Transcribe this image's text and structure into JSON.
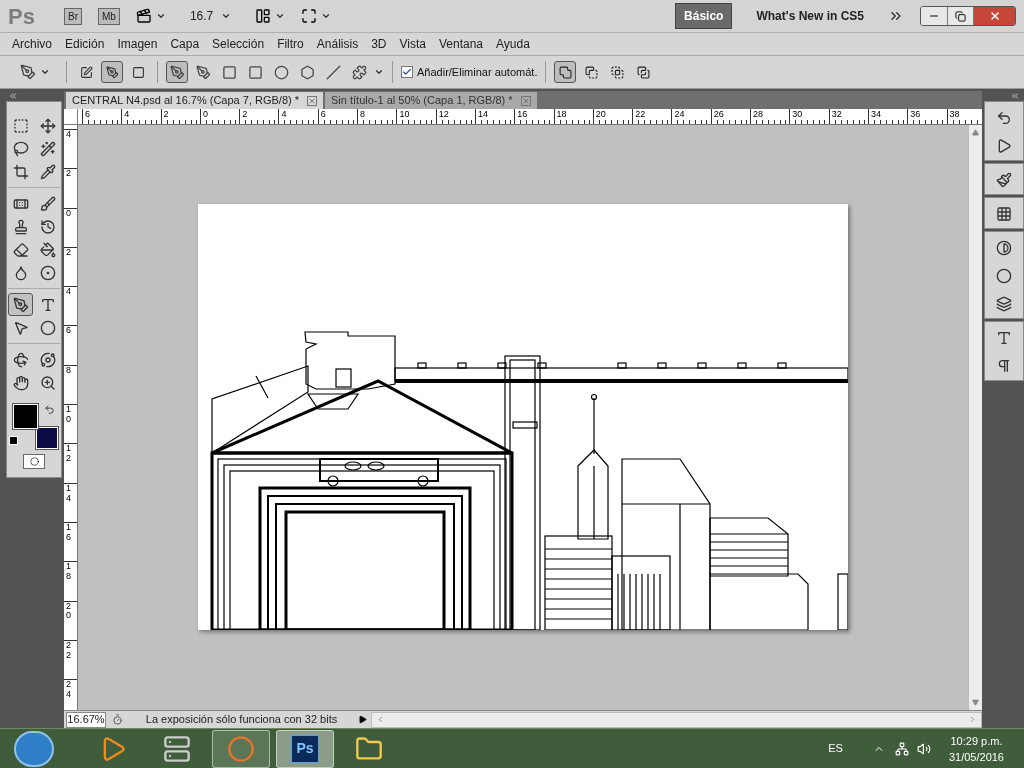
{
  "app_bar": {
    "logo": "Ps",
    "launchers": [
      "Br",
      "Mb"
    ],
    "zoom": "16.7",
    "workspaces": [
      {
        "label": "Básico",
        "selected": true
      },
      {
        "label": "What's New in CS5",
        "selected": false
      }
    ]
  },
  "menu": [
    "Archivo",
    "Edición",
    "Imagen",
    "Capa",
    "Selección",
    "Filtro",
    "Análisis",
    "3D",
    "Vista",
    "Ventana",
    "Ayuda"
  ],
  "options_bar": {
    "path_modes": [
      {
        "kind": "shape-layers",
        "selected": false
      },
      {
        "kind": "paths",
        "selected": true
      },
      {
        "kind": "fill-pixels",
        "selected": false
      }
    ],
    "draw_tools": [
      {
        "kind": "pen",
        "selected": true
      },
      {
        "kind": "freeform-pen",
        "selected": false
      },
      {
        "kind": "rectangle",
        "selected": false
      },
      {
        "kind": "rounded-rectangle",
        "selected": false
      },
      {
        "kind": "ellipse",
        "selected": false
      },
      {
        "kind": "polygon",
        "selected": false
      },
      {
        "kind": "line",
        "selected": false
      },
      {
        "kind": "custom-shape",
        "selected": false
      }
    ],
    "auto_add_delete": {
      "label": "Añadir/Eliminar automát.",
      "checked": true
    },
    "combine_modes": [
      {
        "kind": "add",
        "selected": true
      },
      {
        "kind": "subtract",
        "selected": false
      },
      {
        "kind": "intersect",
        "selected": false
      },
      {
        "kind": "exclude",
        "selected": false
      }
    ]
  },
  "document_tabs": [
    {
      "label": "CENTRAL N4.psd al 16.7% (Capa 7, RGB/8) *",
      "selected": true
    },
    {
      "label": "Sin título-1 al 50% (Capa 1, RGB/8) *",
      "selected": false
    }
  ],
  "rulers": {
    "horizontal": [
      "6",
      "4",
      "2",
      "0",
      "2",
      "4",
      "6",
      "8",
      "10",
      "12",
      "14",
      "16",
      "18",
      "20",
      "22",
      "24",
      "26",
      "28",
      "30",
      "32",
      "34",
      "36",
      "38"
    ],
    "vertical": [
      "4",
      "2",
      "0",
      "2",
      "4",
      "6",
      "8",
      "10",
      "12",
      "14",
      "16",
      "18",
      "20",
      "22",
      "24"
    ]
  },
  "toolbox": {
    "tools": [
      {
        "kind": "marquee",
        "selected": false
      },
      {
        "kind": "move",
        "selected": false
      },
      {
        "kind": "lasso",
        "selected": false
      },
      {
        "kind": "magic-wand",
        "selected": false
      },
      {
        "kind": "crop",
        "selected": false
      },
      {
        "kind": "eyedropper",
        "selected": false
      },
      {
        "kind": "healing",
        "selected": false
      },
      {
        "kind": "brush",
        "selected": false
      },
      {
        "kind": "stamp",
        "selected": false
      },
      {
        "kind": "history-brush",
        "selected": false
      },
      {
        "kind": "eraser",
        "selected": false
      },
      {
        "kind": "bucket",
        "selected": false
      },
      {
        "kind": "blur",
        "selected": false
      },
      {
        "kind": "dodge",
        "selected": false
      },
      {
        "kind": "pen",
        "selected": true
      },
      {
        "kind": "type",
        "selected": false
      },
      {
        "kind": "path-select",
        "selected": false
      },
      {
        "kind": "ellipse",
        "selected": false
      },
      {
        "kind": "rotate-3d",
        "selected": false
      },
      {
        "kind": "orbit-3d",
        "selected": false
      },
      {
        "kind": "hand",
        "selected": false
      },
      {
        "kind": "zoom",
        "selected": false
      }
    ],
    "swatches": [
      {
        "kind": "foreground",
        "color": "#000000"
      },
      {
        "kind": "background",
        "color": "#0b0a45"
      }
    ]
  },
  "status_bar": {
    "zoom": "16.67%",
    "message": "La exposición sólo funciona con 32 bits"
  },
  "dock_panels": [
    [
      {
        "kind": "history"
      },
      {
        "kind": "actions"
      }
    ],
    [
      {
        "kind": "brush-presets"
      }
    ],
    [
      {
        "kind": "swatches"
      }
    ],
    [
      {
        "kind": "adjustments"
      },
      {
        "kind": "masks"
      },
      {
        "kind": "layers"
      }
    ],
    [
      {
        "kind": "character"
      },
      {
        "kind": "paragraph"
      }
    ]
  ],
  "taskbar": {
    "apps": [
      {
        "kind": "media-player",
        "running": false,
        "selected": false
      },
      {
        "kind": "server",
        "running": false,
        "selected": false
      },
      {
        "kind": "firefox",
        "running": true,
        "selected": false
      },
      {
        "kind": "photoshop",
        "label": "Ps",
        "running": true,
        "selected": true
      },
      {
        "kind": "explorer",
        "running": false,
        "selected": false
      }
    ],
    "language": "ES",
    "time": "10:29 p.m.",
    "date": "31/05/2016"
  }
}
